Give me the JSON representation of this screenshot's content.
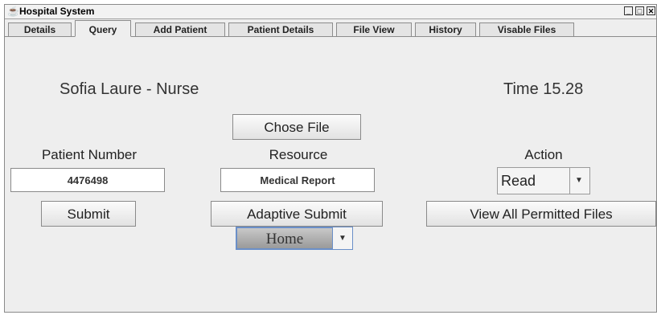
{
  "window": {
    "title": "Hospital System",
    "title_icon": "coffee-cup-icon",
    "controls": {
      "minimize": "_",
      "maximize": "□",
      "close": "✕"
    }
  },
  "tabs": [
    {
      "label": "Details",
      "active": false
    },
    {
      "label": "Query",
      "active": true
    },
    {
      "label": "Add Patient",
      "active": false
    },
    {
      "label": "Patient Details",
      "active": false
    },
    {
      "label": "File View",
      "active": false
    },
    {
      "label": "History",
      "active": false
    },
    {
      "label": "Visable Files",
      "active": false
    }
  ],
  "header": {
    "user": "Sofia Laure - Nurse",
    "time": "Time 15.28"
  },
  "patient": {
    "label": "Patient Number",
    "number": "4476498",
    "submit_label": "Submit"
  },
  "resource": {
    "chose_file_label": "Chose File",
    "label": "Resource",
    "value": "Medical Report",
    "adaptive_submit_label": "Adaptive Submit",
    "home_select": "Home"
  },
  "action": {
    "label": "Action",
    "selected": "Read",
    "view_all_label": "View All Permitted Files"
  }
}
